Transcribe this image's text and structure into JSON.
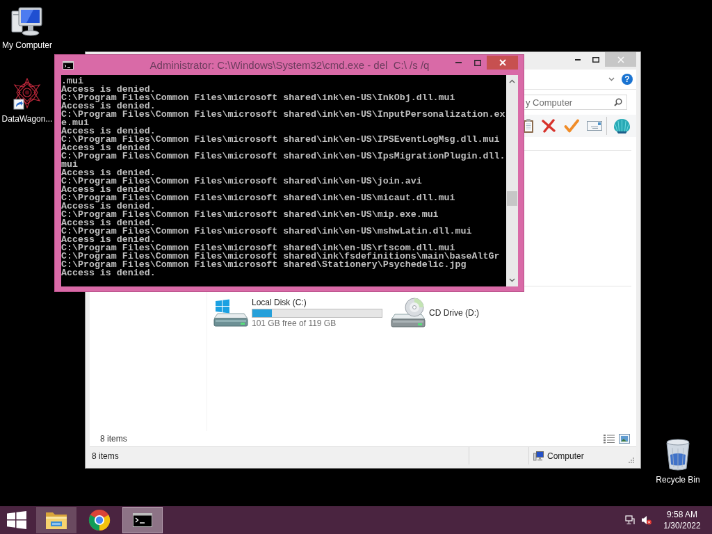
{
  "desktop": {
    "icons": [
      {
        "kind": "computer",
        "label": "My Computer"
      },
      {
        "kind": "shortcut",
        "label": "DataWagon..."
      }
    ],
    "recycle_bin": {
      "label": "Recycle Bin"
    }
  },
  "explorer": {
    "help": "?",
    "search": {
      "placeholder": "y Computer"
    },
    "drives": [
      {
        "kind": "disk",
        "label": "Local Disk (C:)",
        "level": 0.15,
        "free": "101 GB free of 119 GB"
      },
      {
        "kind": "cd",
        "label": "CD Drive (D:)"
      }
    ],
    "item_count": "8 items",
    "status_bar": {
      "count": "8 items",
      "location": "Computer"
    }
  },
  "cmd": {
    "title": "Administrator: C:\\Windows\\System32\\cmd.exe - del  C:\\ /s /q",
    "lines": [
      ".mui",
      "Access is denied.",
      "C:\\Program Files\\Common Files\\microsoft shared\\ink\\en-US\\InkObj.dll.mui",
      "Access is denied.",
      "C:\\Program Files\\Common Files\\microsoft shared\\ink\\en-US\\InputPersonalization.ex",
      "e.mui",
      "Access is denied.",
      "C:\\Program Files\\Common Files\\microsoft shared\\ink\\en-US\\IPSEventLogMsg.dll.mui",
      "Access is denied.",
      "C:\\Program Files\\Common Files\\microsoft shared\\ink\\en-US\\IpsMigrationPlugin.dll.",
      "mui",
      "Access is denied.",
      "C:\\Program Files\\Common Files\\microsoft shared\\ink\\en-US\\join.avi",
      "Access is denied.",
      "C:\\Program Files\\Common Files\\microsoft shared\\ink\\en-US\\micaut.dll.mui",
      "Access is denied.",
      "C:\\Program Files\\Common Files\\microsoft shared\\ink\\en-US\\mip.exe.mui",
      "Access is denied.",
      "C:\\Program Files\\Common Files\\microsoft shared\\ink\\en-US\\mshwLatin.dll.mui",
      "Access is denied.",
      "C:\\Program Files\\Common Files\\microsoft shared\\ink\\en-US\\rtscom.dll.mui",
      "C:\\Program Files\\Common Files\\microsoft shared\\ink\\fsdefinitions\\main\\baseAltGr",
      "C:\\Program Files\\Common Files\\microsoft shared\\Stationery\\Psychedelic.jpg",
      "Access is denied."
    ]
  },
  "taskbar": {
    "apps": [
      {
        "kind": "explorer",
        "running": true,
        "selected": false
      },
      {
        "kind": "browser",
        "running": false,
        "selected": false
      },
      {
        "kind": "terminal",
        "running": true,
        "selected": true
      }
    ],
    "volume": {
      "muted": true
    },
    "clock": {
      "time": "9:58 AM",
      "date": "1/30/2022"
    }
  }
}
